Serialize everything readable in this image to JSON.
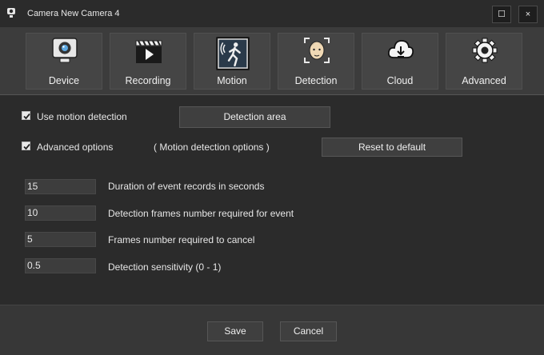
{
  "window": {
    "title": "Camera New Camera 4",
    "maximize_glyph": "☐",
    "close_glyph": "×"
  },
  "toolbar": {
    "items": [
      {
        "label": "Device",
        "icon": "webcam-icon"
      },
      {
        "label": "Recording",
        "icon": "clapperboard-play-icon"
      },
      {
        "label": "Motion",
        "icon": "motion-sensor-icon"
      },
      {
        "label": "Detection",
        "icon": "face-detection-icon"
      },
      {
        "label": "Cloud",
        "icon": "cloud-download-icon"
      },
      {
        "label": "Advanced",
        "icon": "gear-icon"
      }
    ]
  },
  "motion": {
    "use_motion_label": "Use motion detection",
    "use_motion_checked": true,
    "detection_area_label": "Detection area",
    "advanced_label": "Advanced options",
    "advanced_checked": true,
    "options_caption": "( Motion detection options )",
    "reset_label": "Reset to default",
    "fields": [
      {
        "value": "15",
        "label": "Duration of event records in seconds"
      },
      {
        "value": "10",
        "label": "Detection frames number required for event"
      },
      {
        "value": "5",
        "label": "Frames number required to cancel"
      },
      {
        "value": "0.5",
        "label": "Detection sensitivity (0 - 1)"
      }
    ]
  },
  "footer": {
    "save_label": "Save",
    "cancel_label": "Cancel"
  },
  "colors": {
    "background": "#2b2b2b",
    "toolbar": "#3c3c3c",
    "button": "#3f3f3f",
    "field": "#3d3d3d"
  }
}
